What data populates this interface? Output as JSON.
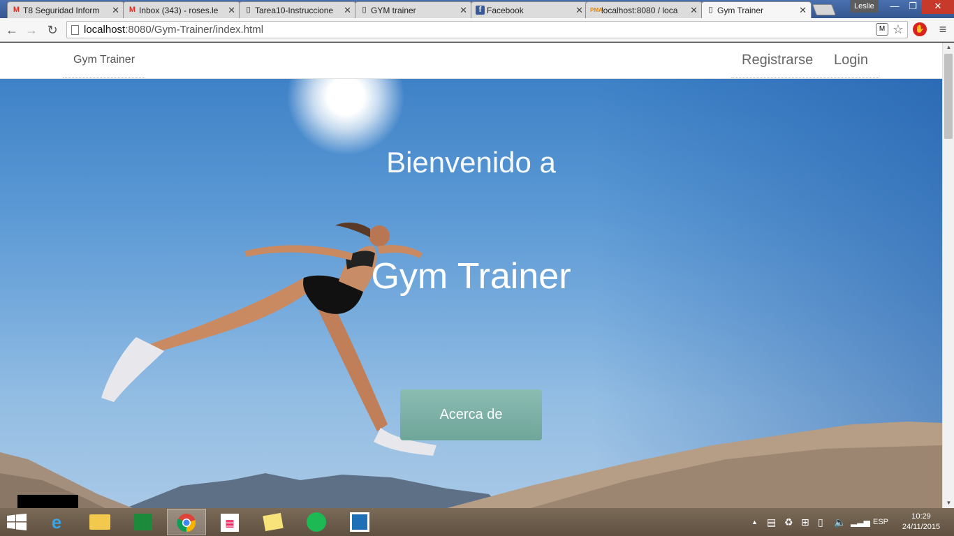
{
  "browser": {
    "tabs": [
      {
        "title": "T8 Seguridad Inform",
        "icon": "gmail-icon",
        "active": false
      },
      {
        "title": "Inbox (343) - roses.le",
        "icon": "gmail-icon",
        "active": false
      },
      {
        "title": "Tarea10-Instruccione",
        "icon": "page-icon",
        "active": false
      },
      {
        "title": "GYM trainer",
        "icon": "page-icon",
        "active": false
      },
      {
        "title": "Facebook",
        "icon": "facebook-icon",
        "active": false
      },
      {
        "title": "localhost:8080 / loca",
        "icon": "phpmyadmin-icon",
        "active": false
      },
      {
        "title": "Gym Trainer",
        "icon": "page-icon",
        "active": true
      }
    ],
    "profile_name": "Leslie",
    "url_host": "localhost",
    "url_path": ":8080/Gym-Trainer/index.html"
  },
  "site": {
    "brand": "Gym Trainer",
    "nav": {
      "register": "Registrarse",
      "login": "Login"
    },
    "hero": {
      "subtitle": "Bienvenido a",
      "title": "Gym Trainer",
      "button": "Acerca de"
    }
  },
  "taskbar": {
    "language": "ESP",
    "time": "10:29",
    "date": "24/11/2015"
  }
}
